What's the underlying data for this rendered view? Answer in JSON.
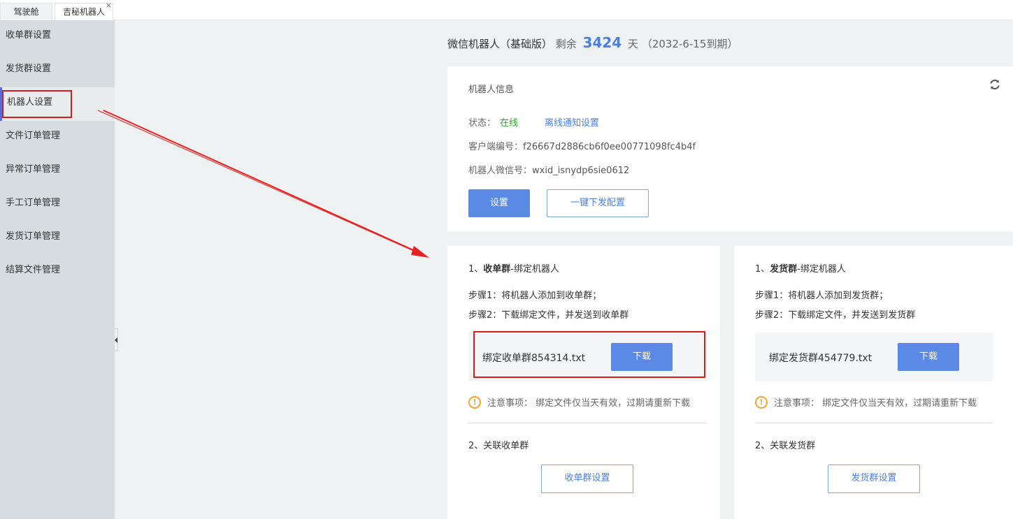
{
  "tabs": [
    {
      "label": "驾驶舱"
    },
    {
      "label": "吉秘机器人",
      "close": "×"
    }
  ],
  "sidebar": {
    "items": [
      {
        "label": "收单群设置"
      },
      {
        "label": "发货群设置"
      },
      {
        "label": "机器人设置"
      },
      {
        "label": "文件订单管理"
      },
      {
        "label": "异常订单管理"
      },
      {
        "label": "手工订单管理"
      },
      {
        "label": "发货订单管理"
      },
      {
        "label": "结算文件管理"
      }
    ],
    "active_index": 2
  },
  "header": {
    "product": "微信机器人（基础版）",
    "remaining_label": "剩余",
    "days": "3424",
    "days_unit": "天",
    "expiry": "（2032-6-15到期）"
  },
  "info": {
    "title": "机器人信息",
    "refresh_icon": "refresh-icon",
    "status_label": "状态：",
    "status_value": "在线",
    "offline_link": "离线通知设置",
    "client_label": "客户端编号：",
    "client_value": "f26667d2886cb6f0ee00771098fc4b4f",
    "wechat_label": "机器人微信号：",
    "wechat_value": "wxid_isnydp6sie0612",
    "settings_button": "设置",
    "push_button": "一键下发配置"
  },
  "groups": {
    "order": {
      "heading_prefix": "1、",
      "heading_bold": "收单群",
      "heading_suffix": "-绑定机器人",
      "step1": "步骤1：将机器人添加到收单群；",
      "step2": "步骤2：下载绑定文件，并发送到收单群",
      "file_name": "绑定收单群854314.txt",
      "download": "下载",
      "notice": "注意事项：  绑定文件仅当天有效，过期请重新下载",
      "sub": "2、关联收单群",
      "settings_button": "收单群设置"
    },
    "ship": {
      "heading_prefix": "1、",
      "heading_bold": "发货群",
      "heading_suffix": "-绑定机器人",
      "step1": "步骤1：将机器人添加到发货群；",
      "step2": "步骤2：下载绑定文件，并发送到发货群",
      "file_name": "绑定发货群454779.txt",
      "download": "下载",
      "notice": "注意事项：  绑定文件仅当天有效，过期请重新下载",
      "sub": "2、关联发货群",
      "settings_button": "发货群设置"
    }
  },
  "colors": {
    "accent": "#5a8ae6",
    "highlight": "#e11818",
    "online": "#2aa42a",
    "warning": "#f0a434"
  }
}
